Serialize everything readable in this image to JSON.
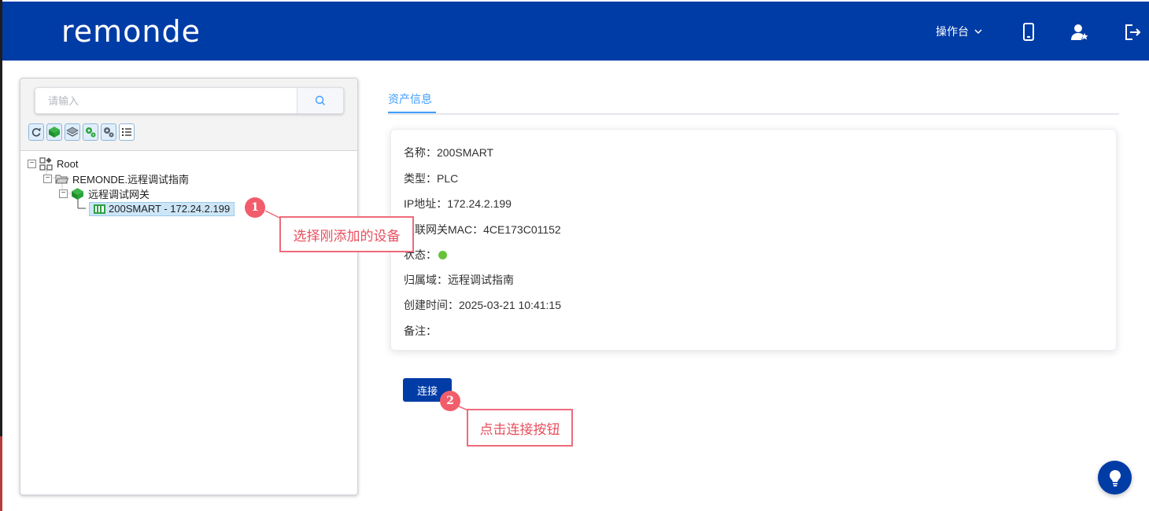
{
  "header": {
    "logo_text": "remonde",
    "console_label": "操作台",
    "icons": [
      "chevron-down-icon",
      "mobile-icon",
      "user-star-icon",
      "logout-icon"
    ]
  },
  "tree_panel": {
    "search_placeholder": "请输入",
    "toolbar_icons": [
      "refresh-icon",
      "gateway-icon",
      "layer-icon",
      "settings-green-icon",
      "settings-gray-icon",
      "list-icon"
    ],
    "nodes": [
      {
        "label": "Root",
        "icon": "root-grid-icon"
      },
      {
        "label": "REMONDE.远程调试指南",
        "icon": "folder-icon"
      },
      {
        "label": "远程调试网关",
        "icon": "gateway-icon"
      },
      {
        "label": "200SMART - 172.24.2.199",
        "icon": "plc-device-icon",
        "selected": true
      }
    ]
  },
  "tabs": [
    {
      "label": "资产信息",
      "active": true
    }
  ],
  "asset_info": {
    "name_row": "名称：200SMART",
    "type_row": "类型：PLC",
    "ip_row": "IP地址：172.24.2.199",
    "mac_row": "关联网关MAC：4CE173C01152",
    "status_row": "状态：",
    "status_color": "#67c23a",
    "domain_row": "归属域：远程调试指南",
    "created_row": "创建时间：2025-03-21 10:41:15",
    "remark_row": "备注："
  },
  "connect_button": "连接",
  "annotations": [
    {
      "number": "1",
      "text": "选择刚添加的设备"
    },
    {
      "number": "2",
      "text": "点击连接按钮"
    }
  ],
  "colors": {
    "brand": "#003ca6",
    "accent": "#409eff",
    "annotation": "#f25d6c"
  }
}
